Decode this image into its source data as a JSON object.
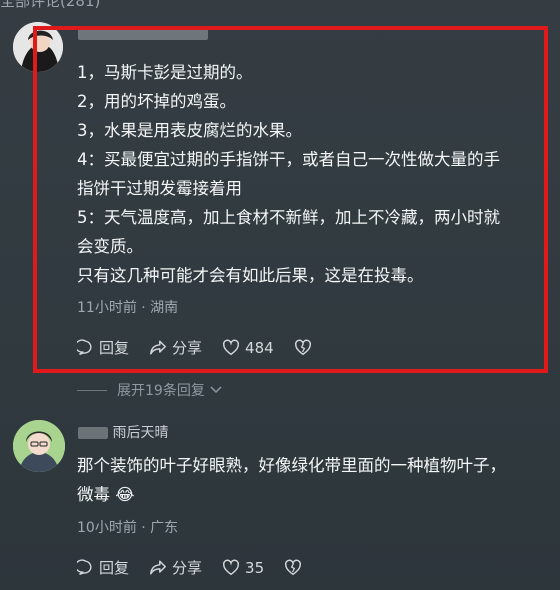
{
  "header": {
    "label": "全部评论(281)"
  },
  "comments": [
    {
      "lines": [
        "1，马斯卡彭是过期的。",
        "2，用的坏掉的鸡蛋。",
        "3，水果是用表皮腐烂的水果。",
        "4：买最便宜过期的手指饼干，或者自己一次性做大量的手",
        "指饼干过期发霉接着用",
        "5：天气温度高，加上食材不新鲜，加上不冷藏，两小时就",
        "会变质。",
        "只有这几种可能才会有如此后果，这是在投毒。"
      ],
      "meta": "11小时前 · 湖南",
      "reply_label": "回复",
      "share_label": "分享",
      "like_count": "484"
    },
    {
      "username_visible": "雨后天晴",
      "lines": [
        "那个装饰的叶子好眼熟，好像绿化带里面的一种植物叶子，",
        "微毒 😂"
      ],
      "meta": "10小时前 · 广东",
      "reply_label": "回复",
      "share_label": "分享",
      "like_count": "35"
    }
  ],
  "expand_replies": "展开19条回复",
  "colors": {
    "highlight": "#e0191b",
    "background": "#323a3f"
  }
}
